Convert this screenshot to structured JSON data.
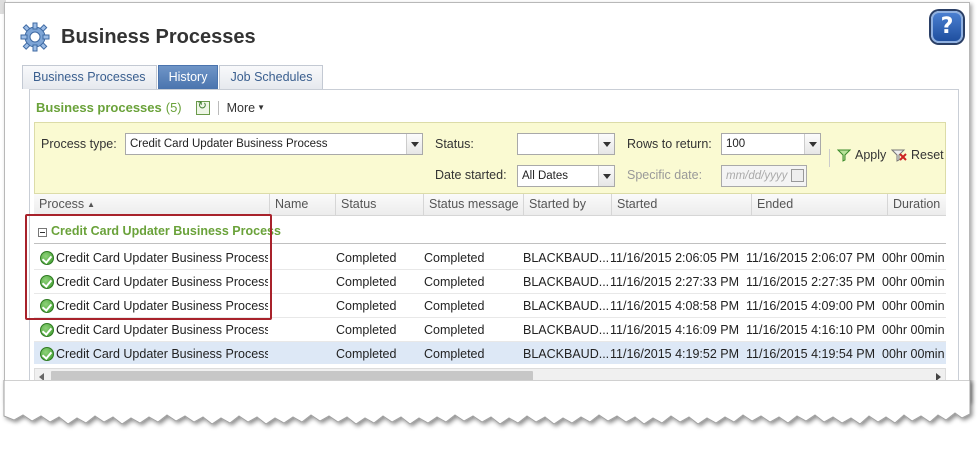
{
  "page": {
    "title": "Business Processes",
    "help_label": "?"
  },
  "tabs": [
    {
      "label": "Business Processes",
      "active": false
    },
    {
      "label": "History",
      "active": true
    },
    {
      "label": "Job Schedules",
      "active": false
    }
  ],
  "panel": {
    "title": "Business processes",
    "count": "(5)",
    "more_label": "More"
  },
  "filter": {
    "process_type_label": "Process type:",
    "process_type_value": "Credit Card Updater Business Process",
    "status_label": "Status:",
    "status_value": "",
    "rows_label": "Rows to return:",
    "rows_value": "100",
    "date_started_label": "Date started:",
    "date_started_value": "All Dates",
    "specific_date_label": "Specific date:",
    "specific_date_placeholder": "mm/dd/yyyy",
    "apply_label": "Apply",
    "reset_label": "Reset"
  },
  "grid": {
    "columns": [
      "Process",
      "Name",
      "Status",
      "Status message",
      "Started by",
      "Started",
      "Ended",
      "Duration"
    ],
    "sort_indicator": "▲",
    "group_label": "Credit Card Updater Business Process",
    "rows": [
      {
        "process": "Credit Card Updater Business Process",
        "name": "",
        "status": "Completed",
        "message": "Completed",
        "started_by": "BLACKBAUD...",
        "started": "11/16/2015 2:06:05 PM",
        "ended": "11/16/2015 2:06:07 PM",
        "duration": "00hr 00min"
      },
      {
        "process": "Credit Card Updater Business Process",
        "name": "",
        "status": "Completed",
        "message": "Completed",
        "started_by": "BLACKBAUD...",
        "started": "11/16/2015 2:27:33 PM",
        "ended": "11/16/2015 2:27:35 PM",
        "duration": "00hr 00min"
      },
      {
        "process": "Credit Card Updater Business Process",
        "name": "",
        "status": "Completed",
        "message": "Completed",
        "started_by": "BLACKBAUD...",
        "started": "11/16/2015 4:08:58 PM",
        "ended": "11/16/2015 4:09:00 PM",
        "duration": "00hr 00min"
      },
      {
        "process": "Credit Card Updater Business Process",
        "name": "",
        "status": "Completed",
        "message": "Completed",
        "started_by": "BLACKBAUD...",
        "started": "11/16/2015 4:16:09 PM",
        "ended": "11/16/2015 4:16:10 PM",
        "duration": "00hr 00min"
      },
      {
        "process": "Credit Card Updater Business Process",
        "name": "",
        "status": "Completed",
        "message": "Completed",
        "started_by": "BLACKBAUD...",
        "started": "11/16/2015 4:19:52 PM",
        "ended": "11/16/2015 4:19:54 PM",
        "duration": "00hr 00min",
        "selected": true
      }
    ]
  },
  "colors": {
    "accent_green": "#6aa23a",
    "tab_active": "#4a74ae",
    "filter_bg": "#fafad2",
    "highlight_border": "#a8222b",
    "selected_row": "#dde8f6"
  },
  "icons": {
    "header": "gear-process-icon",
    "refresh": "refresh-icon",
    "apply": "filter-funnel-icon",
    "reset": "filter-reset-icon",
    "row_status": "check-circle-icon",
    "help": "help-icon"
  }
}
